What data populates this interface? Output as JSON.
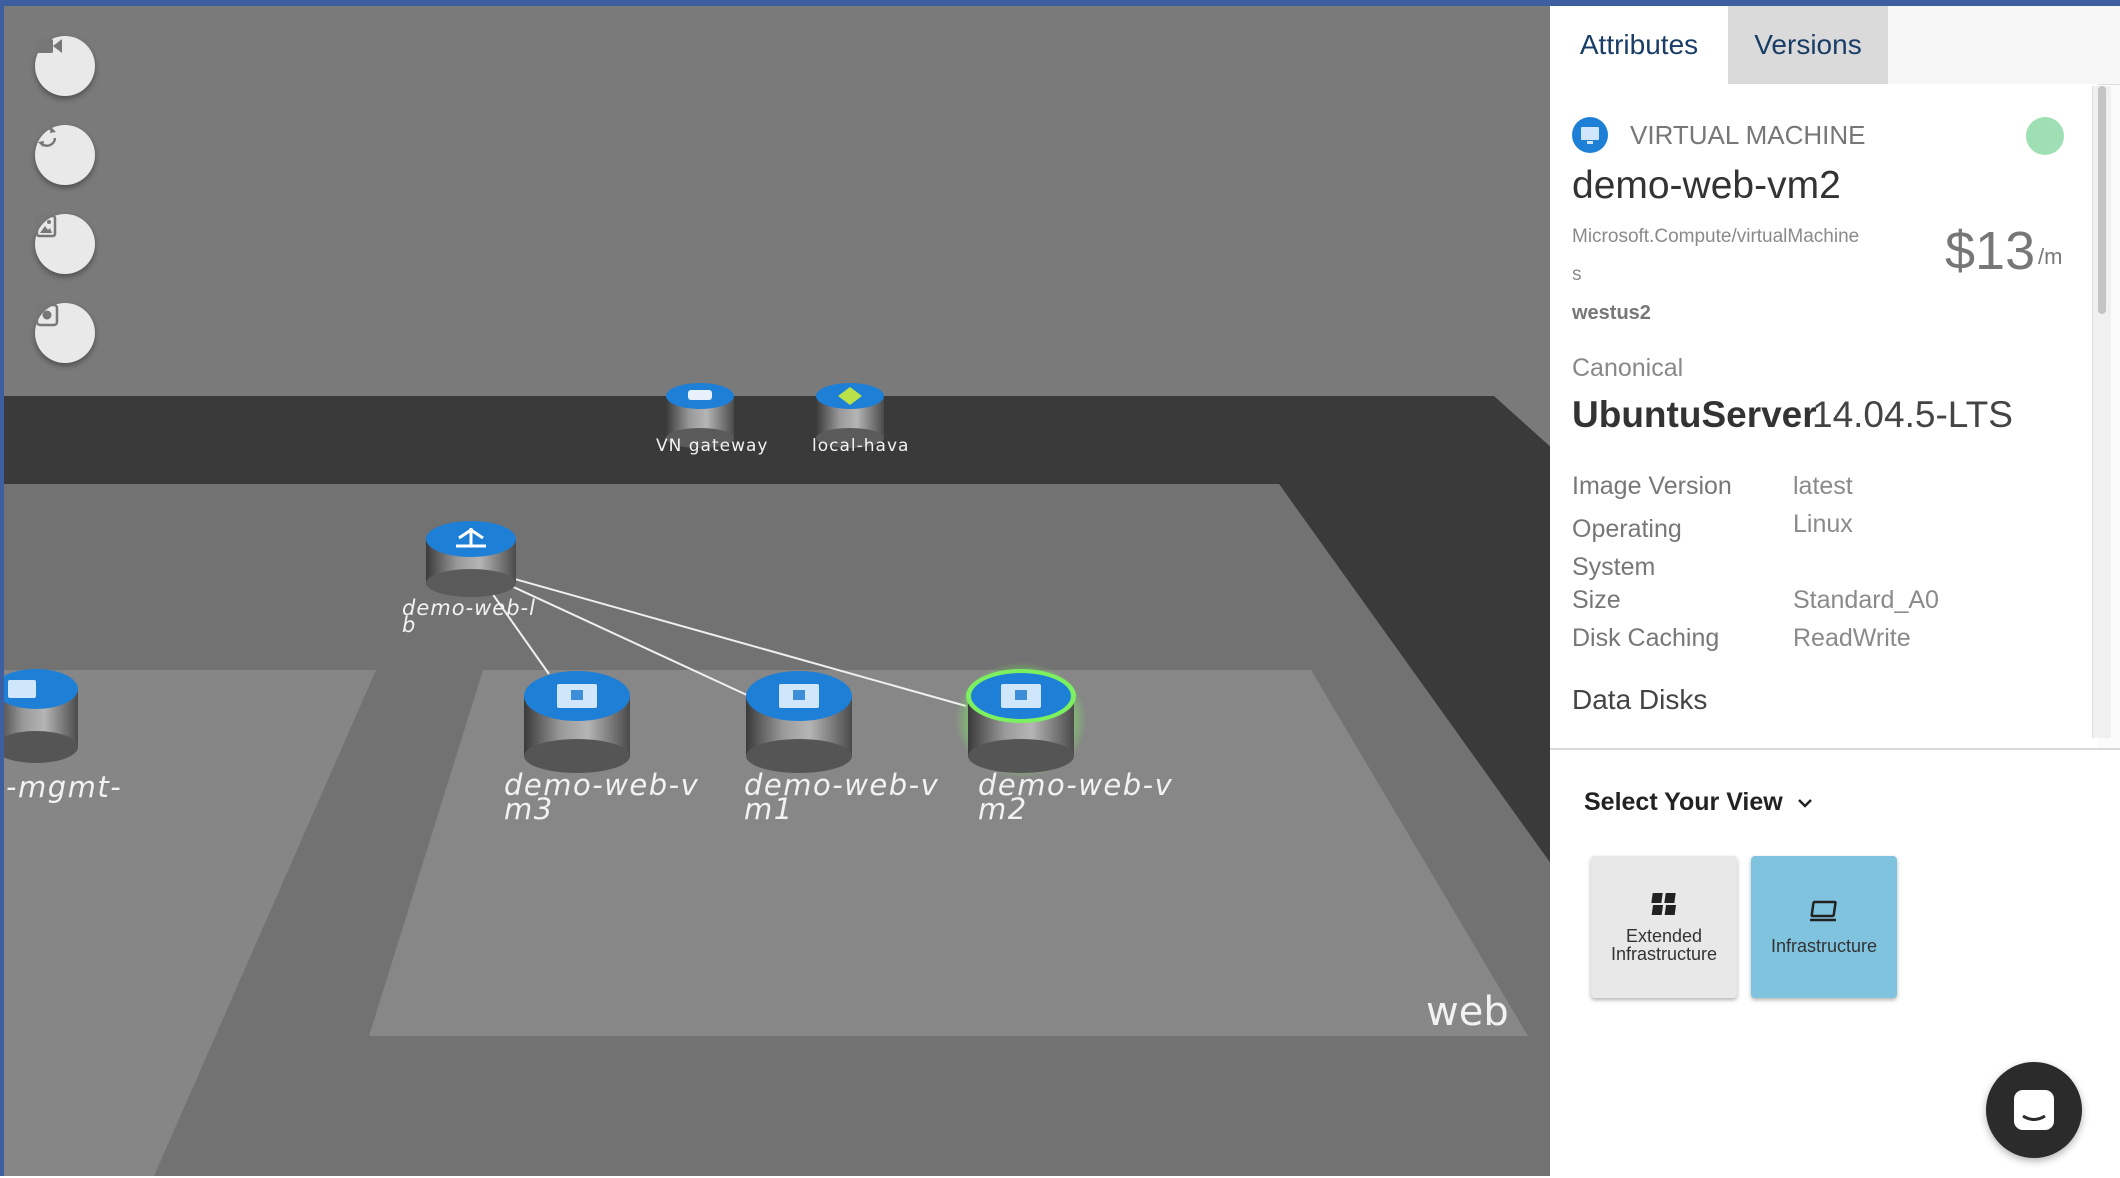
{
  "toolbar": {
    "buttons": [
      {
        "name": "camera-button",
        "icon": "video-camera-icon"
      },
      {
        "name": "refresh-button",
        "icon": "refresh-icon"
      },
      {
        "name": "image-export-button",
        "icon": "image-icon"
      },
      {
        "name": "focus-button",
        "icon": "record-icon"
      }
    ]
  },
  "scene": {
    "top_nodes": {
      "gateway": "VN  gateway",
      "local": "local-hava"
    },
    "lb_label": "demo-web-l\nb",
    "mgmt_label": "-mgmt-",
    "vms": [
      {
        "label": "demo-web-v\nm3"
      },
      {
        "label": "demo-web-v\nm1"
      },
      {
        "label": "demo-web-v\nm2",
        "selected": true
      }
    ],
    "zone_label": "web",
    "colors": {
      "floor": "#7a7a7a",
      "zone": "#8c8c8c",
      "dark_band": "#3b3b3b",
      "node_top": "#1e7fd6",
      "selected_glow": "#7cf060"
    }
  },
  "panel": {
    "tabs": {
      "attributes": "Attributes",
      "versions": "Versions"
    },
    "resource_type": "VIRTUAL MACHINE",
    "status_color": "#9fdfb4",
    "name": "demo-web-vm2",
    "provider_line1": "Microsoft.Compute/virtualMachine",
    "provider_line2": "s",
    "region": "westus2",
    "cost": "$13",
    "cost_unit": "/m",
    "publisher": "Canonical",
    "offer": "UbuntuServer",
    "sku": "14.04.5-LTS",
    "attributes": [
      {
        "key": "Image Version",
        "value": "latest"
      },
      {
        "key": "Operating\nSystem",
        "value": "Linux"
      },
      {
        "key": "Size",
        "value": "Standard_A0"
      },
      {
        "key": "Disk Caching",
        "value": "ReadWrite"
      }
    ],
    "section_title": "Data Disks"
  },
  "view_selector": {
    "label": "Select Your View",
    "options": [
      {
        "label": "Extended\nInfrastructure",
        "active": false
      },
      {
        "label": "Infrastructure",
        "active": true
      }
    ],
    "active_color": "#7fc3df"
  },
  "chat": {
    "icon": "chat-icon"
  }
}
